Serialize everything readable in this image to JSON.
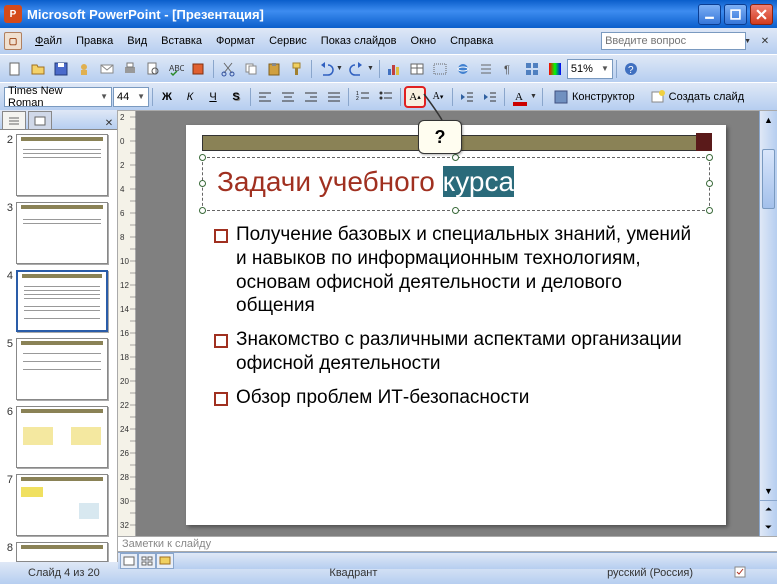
{
  "app": {
    "title": "Microsoft PowerPoint - [Презентация]"
  },
  "menu": {
    "file": "Файл",
    "edit": "Правка",
    "view": "Вид",
    "insert": "Вставка",
    "format": "Формат",
    "tools": "Сервис",
    "slideshow": "Показ слайдов",
    "window": "Окно",
    "help": "Справка",
    "help_placeholder": "Введите вопрос"
  },
  "toolbar": {
    "font_name": "Times New Roman",
    "font_size": "44",
    "zoom": "51%",
    "designer": "Конструктор",
    "new_slide": "Создать слайд"
  },
  "callout": {
    "text": "?"
  },
  "thumbs": {
    "numbers": [
      "2",
      "3",
      "4",
      "5",
      "6",
      "7",
      "8"
    ],
    "selected_index": 2
  },
  "slide": {
    "title_word1": "Задачи учебного ",
    "title_word2": "курса",
    "bullets": [
      "Получение базовых и специальных знаний, умений и навыков по информационным технологиям, основам офисной деятельности и делового общения",
      "Знакомство с различными аспектами организации офисной деятельности",
      "Обзор проблем ИТ-безопасности"
    ]
  },
  "notes": {
    "placeholder": "Заметки к слайду"
  },
  "status": {
    "slide": "Слайд 4 из 20",
    "layout": "Квадрант",
    "lang": "русский (Россия)"
  }
}
